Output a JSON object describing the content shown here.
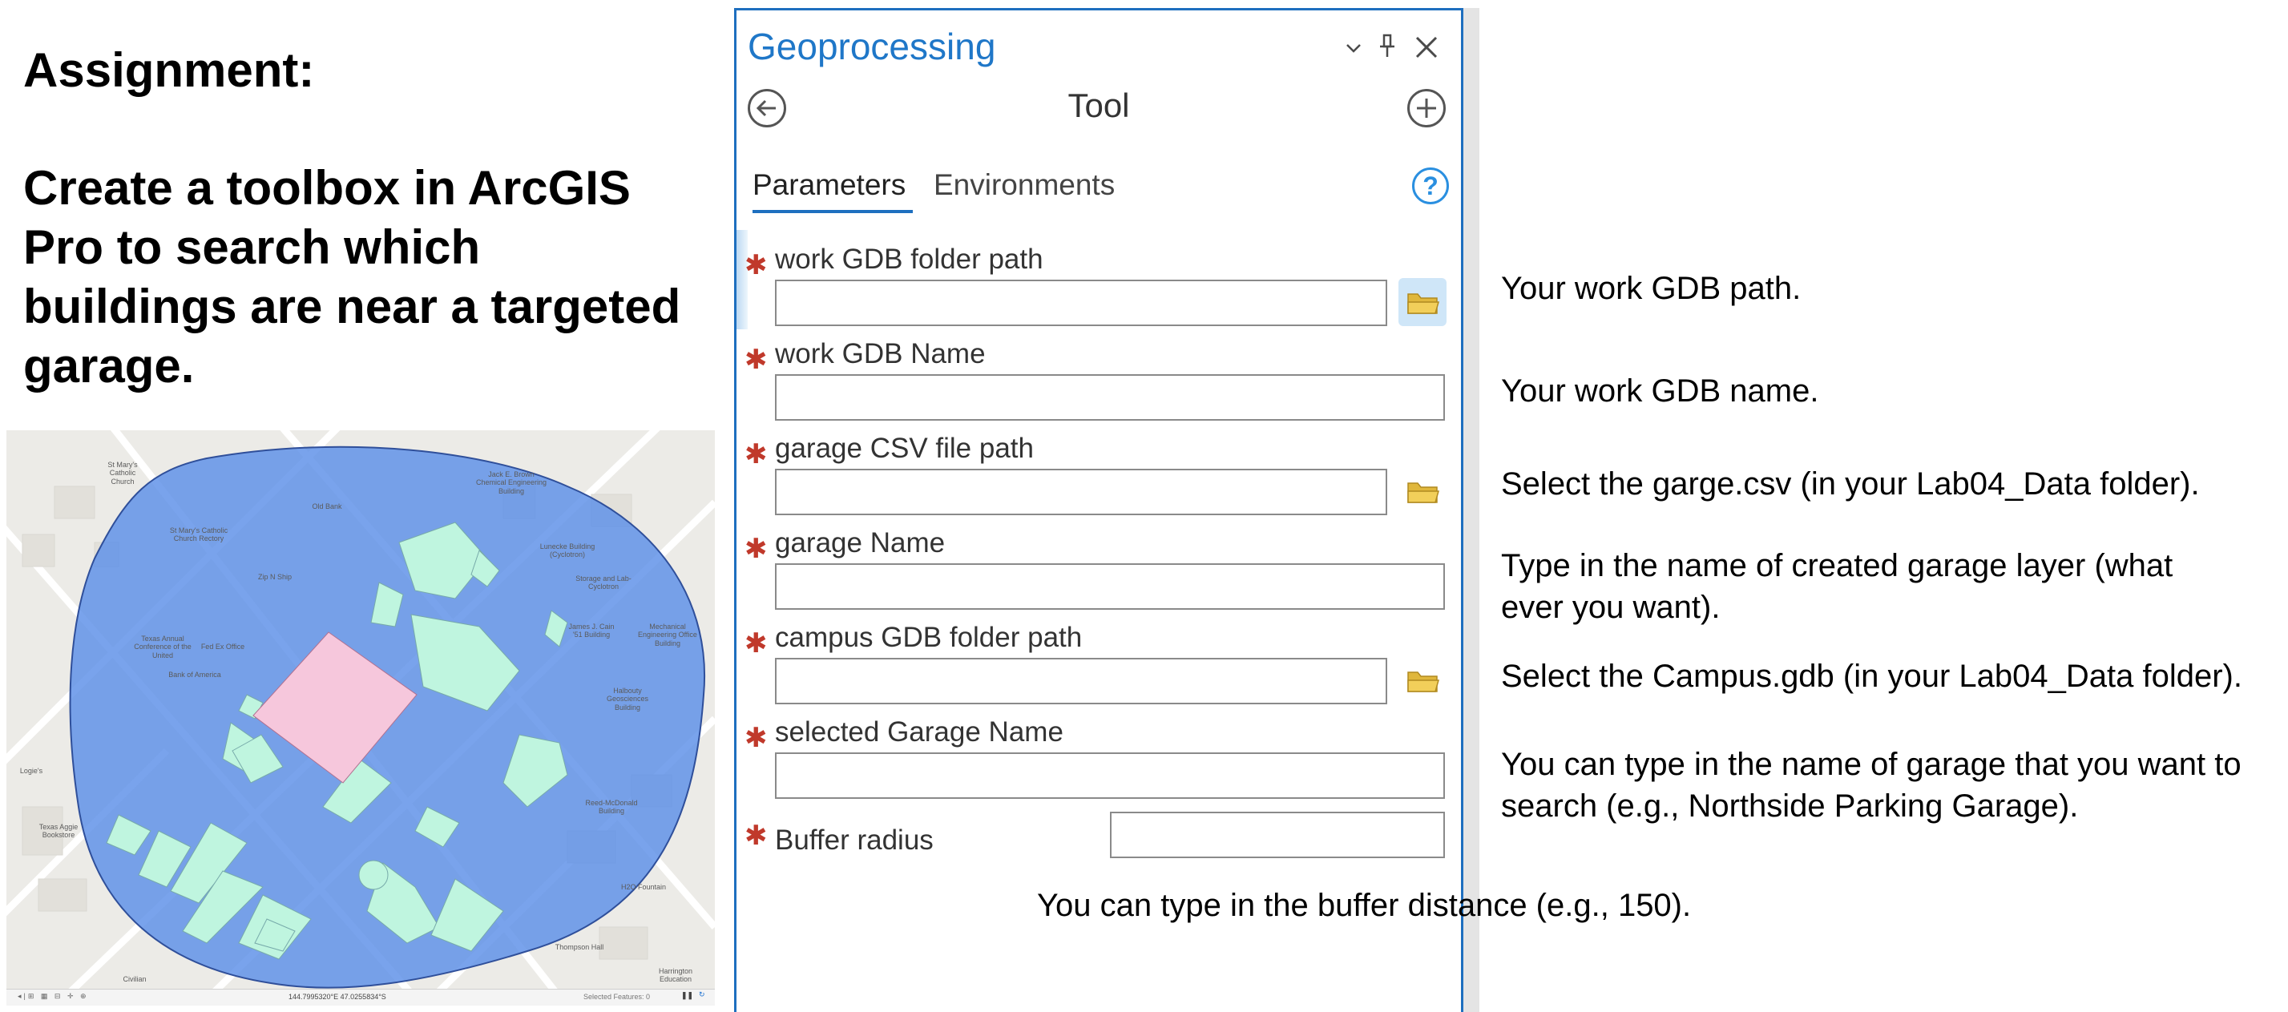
{
  "slide": {
    "title": "Assignment:",
    "body_lines": [
      "Create a toolbox in ArcGIS",
      "Pro to search which",
      "buildings are near a targeted",
      "garage."
    ]
  },
  "map": {
    "colors": {
      "buffer": "#5b8fe8",
      "target_building": "#f6c7dc",
      "nearby_buildings": "#bff5df",
      "background": "#ecebe7"
    },
    "labels": [
      "St Mary's Catholic Church",
      "Jack E. Brown Chemical Engineering Building",
      "St Mary's Catholic Church Rectory",
      "Lunecke Building (Cyclotron)",
      "Storage and Lab-Cyclotron",
      "James J. Cain '51 Building",
      "Mechanical Engineering Office Building",
      "Texas Annual Conference of the United",
      "Fed Ex Office",
      "Bank of America",
      "Halbouty Geosciences Building",
      "Reed-McDonald Building",
      "Texas Aggie Bookstore",
      "H2O Fountain",
      "Thompson Hall",
      "Harrington Education",
      "Civilian",
      "Old Bank",
      "Zip N Ship",
      "Logie's"
    ],
    "status_bar": {
      "coordinates": "144.7995320°E 47.0255834°S",
      "selected": "Selected Features: 0"
    }
  },
  "geoprocessing": {
    "title": "Geoprocessing",
    "heading": "Tool",
    "icons": {
      "collapse": "chevron-down-icon",
      "pin": "pin-icon",
      "close": "close-icon",
      "back": "back-arrow-icon",
      "add": "add-icon",
      "help": "help-icon",
      "folder": "folder-icon"
    },
    "tabs": [
      "Parameters",
      "Environments"
    ],
    "active_tab": "Parameters",
    "help_glyph": "?",
    "accent": "#1e6fbf",
    "required_color": "#c0392b",
    "required_mark": "✱",
    "parameters": [
      {
        "label": "work GDB folder path",
        "value": "",
        "has_browse": true
      },
      {
        "label": "work GDB Name",
        "value": "",
        "has_browse": false
      },
      {
        "label": "garage CSV file path",
        "value": "",
        "has_browse": true
      },
      {
        "label": "garage Name",
        "value": "",
        "has_browse": false
      },
      {
        "label": "campus GDB folder path",
        "value": "",
        "has_browse": true
      },
      {
        "label": "selected Garage Name",
        "value": "",
        "has_browse": false
      },
      {
        "label": "Buffer radius",
        "value": "",
        "has_browse": false
      }
    ]
  },
  "notes": [
    {
      "lines": [
        "Your work GDB path."
      ]
    },
    {
      "lines": [
        "Your work GDB name."
      ]
    },
    {
      "lines": [
        "Select the garge.csv (in your Lab04_Data folder)."
      ]
    },
    {
      "lines": [
        "Type in the name of created garage layer (what",
        "ever you want)."
      ]
    },
    {
      "lines": [
        "Select the Campus.gdb (in your Lab04_Data folder)."
      ]
    },
    {
      "lines": [
        "You can type in the name of garage that you want to",
        "search (e.g., Northside Parking Garage)."
      ]
    },
    {
      "lines": [
        "You can type in the buffer distance (e.g., 150)."
      ]
    }
  ]
}
